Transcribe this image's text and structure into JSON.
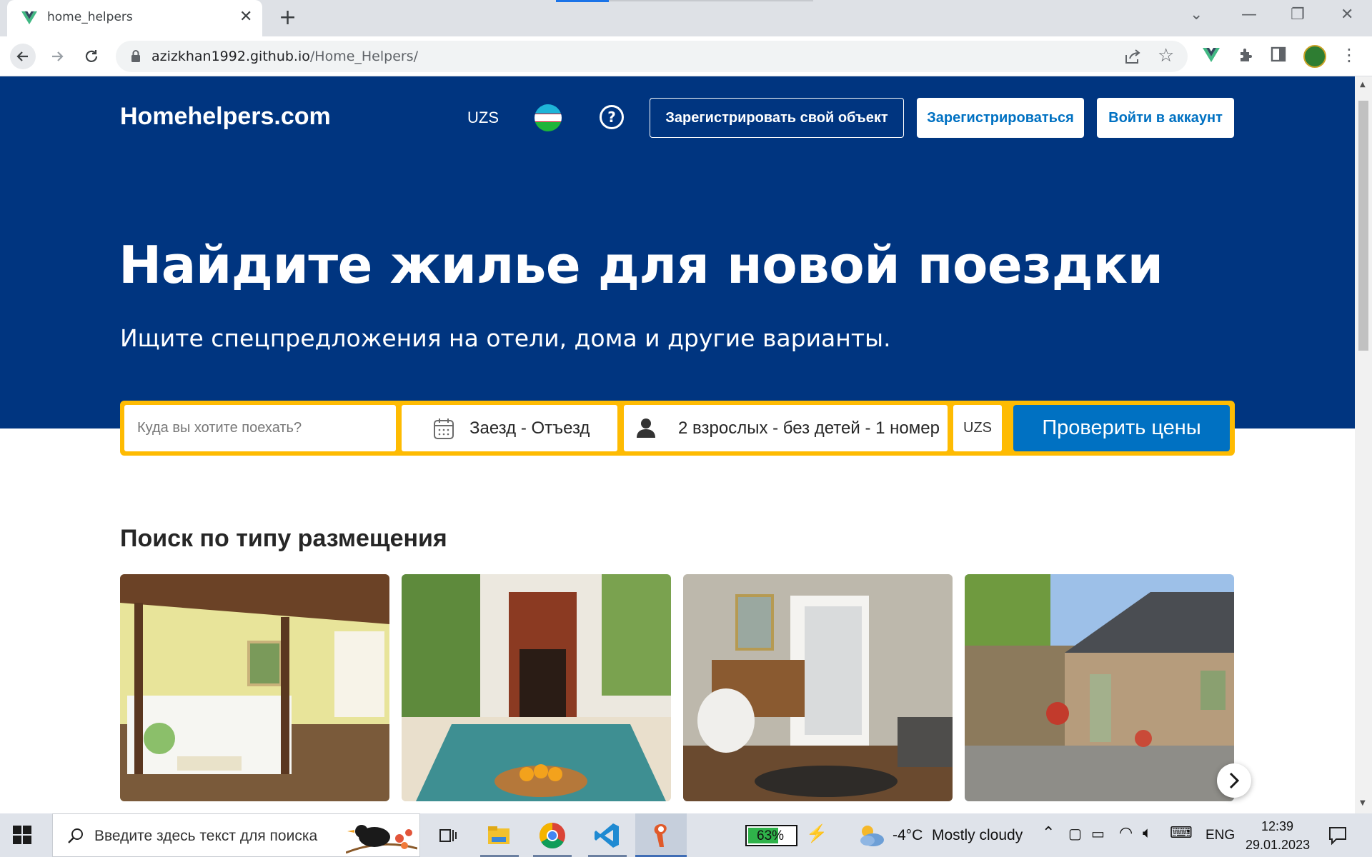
{
  "browser": {
    "tab_title": "home_helpers",
    "url_domain": "azizkhan1992.github.io",
    "url_path": "/Home_Helpers/"
  },
  "header": {
    "logo": "Homehelpers.com",
    "currency": "UZS",
    "list_property_label": "Зарегистрировать свой объект",
    "register_label": "Зарегистрироваться",
    "signin_label": "Войти в аккаунт"
  },
  "hero": {
    "title": "Найдите жилье для новой поездки",
    "subtitle": "Ищите спецпредложения на отели, дома и другие варианты."
  },
  "search": {
    "destination_placeholder": "Куда вы хотите поехать?",
    "dates_label": "Заезд - Отъезд",
    "guests_label": "2 взрослых - без детей - 1 номер",
    "currency": "UZS",
    "button_label": "Проверить цены"
  },
  "section": {
    "title": "Поиск по типу размещения"
  },
  "taskbar": {
    "search_placeholder": "Введите здесь текст для поиска",
    "battery": "63%",
    "temperature": "-4°C",
    "weather": "Mostly cloudy",
    "language": "ENG",
    "time": "12:39",
    "date": "29.01.2023"
  },
  "colors": {
    "brand_blue": "#003580",
    "accent_yellow": "#febb02",
    "action_blue": "#0071c2"
  }
}
